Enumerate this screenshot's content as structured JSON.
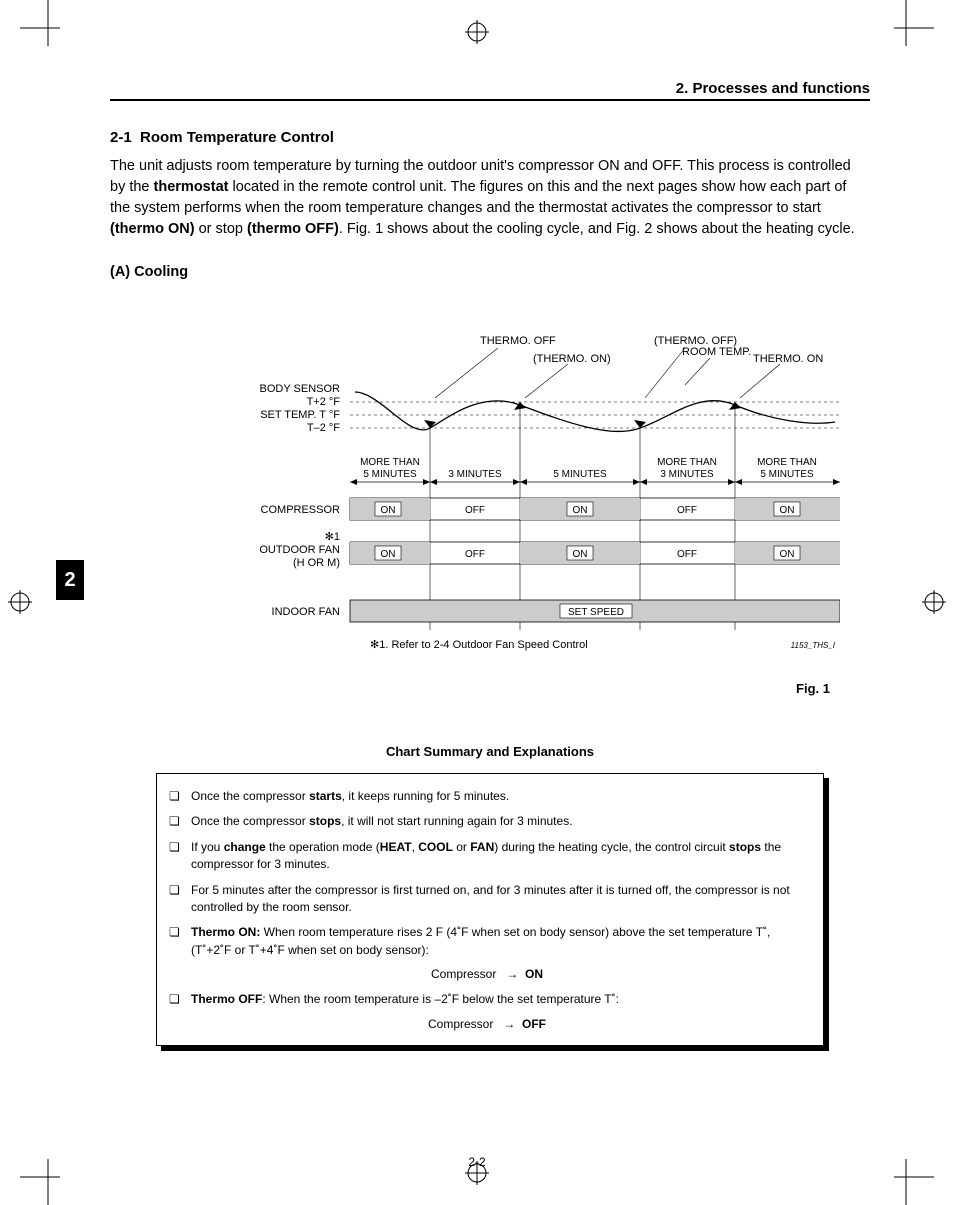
{
  "header": {
    "chapter": "2. Processes and functions"
  },
  "section": {
    "number": "2-1",
    "title": "Room Temperature Control",
    "paragraph": "The unit adjusts room temperature by turning the outdoor unit's compressor ON and OFF. This process is controlled by the thermostat located in the remote control unit. The figures on this and the next pages show how each part of the system performs when the room temperature changes and the thermostat activates the compressor to start (thermo ON) or stop (thermo OFF). Fig. 1 shows about the cooling cycle, and Fig. 2 shows about the heating cycle.",
    "sub_a": "(A) Cooling"
  },
  "tab_number": "2",
  "figure": {
    "caption": "Fig. 1",
    "footnote": "✻1.  Refer  to  2-4  Outdoor Fan Speed Control",
    "code": "1153_THS_I",
    "labels": {
      "thermo_off": "THERMO.  OFF",
      "thermo_off2": "(THERMO.  OFF)",
      "thermo_on": "(THERMO.  ON)",
      "thermo_on2": "THERMO.  ON",
      "room_temp": "ROOM TEMP.",
      "body_sensor": "BODY SENSOR",
      "t_plus2": "T+2 °F",
      "set_temp": "SET TEMP.  T °F",
      "t_minus2": "T–2 °F",
      "more5a": "MORE THAN",
      "more5b": "5 MINUTES",
      "t3min": "3 MINUTES",
      "t5min": "5 MINUTES",
      "more3a": "MORE THAN",
      "more3b": "3 MINUTES",
      "compressor": "COMPRESSOR",
      "outdoor_fan1": "✻1",
      "outdoor_fan2": "OUTDOOR FAN",
      "outdoor_fan3": "(H   OR   M)",
      "indoor_fan": "INDOOR FAN",
      "on": "ON",
      "off": "OFF",
      "set_speed": "SET SPEED"
    }
  },
  "summary": {
    "title": "Chart Summary and Explanations",
    "bullets": [
      "Once the compressor <b>starts</b>, it keeps running for 5 minutes.",
      "Once the compressor <b>stops</b>, it will not start running again for 3 minutes.",
      "If you <b>change</b> the operation mode (<b>HEAT</b>, <b>COOL</b> or <b>FAN</b>) during the heating cycle, the control circuit <b>stops</b> the compressor for 3 minutes.",
      "For 5 minutes after the compressor is first turned on, and for 3 minutes after it is turned off, the compressor is not controlled by the room sensor.",
      "<b>Thermo ON:</b> When room temperature rises 2 F (4˚F when set on body sensor) above the set temperature T˚, (T˚+2˚F or T˚+4˚F when set on body sensor):",
      "<b>Thermo OFF</b>: When the room temperature is –2˚F below the set temperature T˚:"
    ],
    "comp_on": "Compressor   →   ON",
    "comp_off": "Compressor   →   OFF"
  },
  "page_number": "2-2",
  "chart_data": {
    "type": "timing-diagram",
    "title": "(A) Cooling — thermostat control of compressor, outdoor fan, indoor fan",
    "y_reference_lines": [
      "T+2 °F (body sensor)",
      "T °F (set temp)",
      "T–2 °F"
    ],
    "room_temp_trace": "oscillates: starts above T+2, falls through T and T–2 (thermo OFF), rises back through T to T+2 (thermo ON), falls again (thermo OFF), rises again (thermo ON)",
    "segments": [
      {
        "idx": 1,
        "duration_label": "MORE THAN 5 MINUTES",
        "compressor": "ON",
        "outdoor_fan": "ON"
      },
      {
        "idx": 2,
        "duration_label": "3 MINUTES",
        "compressor": "OFF",
        "outdoor_fan": "OFF"
      },
      {
        "idx": 3,
        "duration_label": "5 MINUTES",
        "compressor": "ON",
        "outdoor_fan": "ON"
      },
      {
        "idx": 4,
        "duration_label": "MORE THAN 3 MINUTES",
        "compressor": "OFF",
        "outdoor_fan": "OFF"
      },
      {
        "idx": 5,
        "duration_label": "MORE THAN 5 MINUTES",
        "compressor": "ON",
        "outdoor_fan": "ON"
      }
    ],
    "indoor_fan": "SET SPEED (continuous)",
    "events": [
      {
        "at_end_of_segment": 1,
        "event": "THERMO. OFF"
      },
      {
        "at_end_of_segment": 2,
        "event": "(THERMO. ON)"
      },
      {
        "at_end_of_segment": 3,
        "event": "(THERMO. OFF)"
      },
      {
        "at_end_of_segment": 4,
        "event": "THERMO. ON"
      }
    ],
    "footnote": "✻1 Refer to 2-4 Outdoor Fan Speed Control"
  }
}
